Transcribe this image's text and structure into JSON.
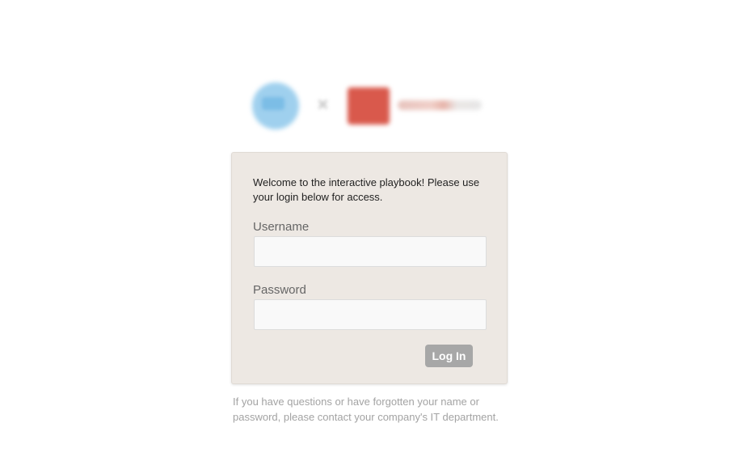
{
  "brand": {
    "logos": [
      "circle-logo",
      "times-icon",
      "square-logo"
    ]
  },
  "login": {
    "welcome": "Welcome to the interactive playbook! Please use your login below for access.",
    "username_label": "Username",
    "username_value": "",
    "password_label": "Password",
    "password_value": "",
    "submit_label": "Log In"
  },
  "help": {
    "text": "If you have questions or have forgotten your name or password, please contact your company's IT department."
  },
  "colors": {
    "card_background": "#ede8e3",
    "button_background": "#a7a7a7",
    "help_text": "#a3a3a3"
  }
}
